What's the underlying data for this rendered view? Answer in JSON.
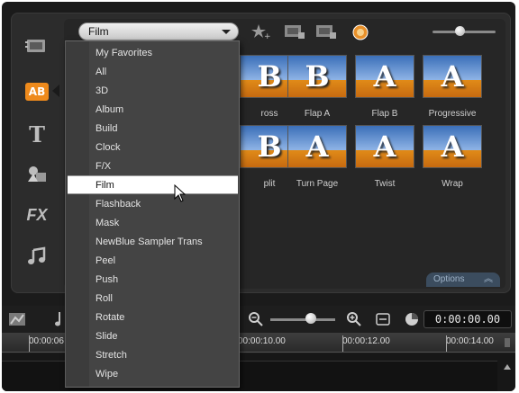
{
  "library": {
    "category_selected": "Film",
    "thumbnails": [
      {
        "label": "ross",
        "letter": "B"
      },
      {
        "label": "Flap A",
        "letter": "B"
      },
      {
        "label": "Flap B",
        "letter": "A"
      },
      {
        "label": "Progressive",
        "letter": "A"
      },
      {
        "label": "plit",
        "letter": "B"
      },
      {
        "label": "Turn Page",
        "letter": "A"
      },
      {
        "label": "Twist",
        "letter": "A"
      },
      {
        "label": "Wrap",
        "letter": "A"
      }
    ],
    "options_label": "Options"
  },
  "sidebar": {
    "items": [
      {
        "icon": "media-icon"
      },
      {
        "icon": "transition-icon",
        "label": "AB"
      },
      {
        "icon": "title-icon",
        "label": "T"
      },
      {
        "icon": "graphic-icon"
      },
      {
        "icon": "filter-icon",
        "label": "FX"
      },
      {
        "icon": "music-icon"
      }
    ]
  },
  "dropdown": {
    "items": [
      "My Favorites",
      "All",
      "3D",
      "Album",
      "Build",
      "Clock",
      "F/X",
      "Film",
      "Flashback",
      "Mask",
      "NewBlue Sampler Trans",
      "Peel",
      "Push",
      "Roll",
      "Rotate",
      "Slide",
      "Stretch",
      "Wipe"
    ],
    "selected_index": 7
  },
  "timeline": {
    "timecode": "0:00:00.00",
    "ruler_labels": [
      "00:00:06",
      "00:00:10.00",
      "00:00:12.00",
      "00:00:14.00"
    ]
  },
  "colors": {
    "accent": "#ee8a1c",
    "panel": "#2c2c2c"
  }
}
